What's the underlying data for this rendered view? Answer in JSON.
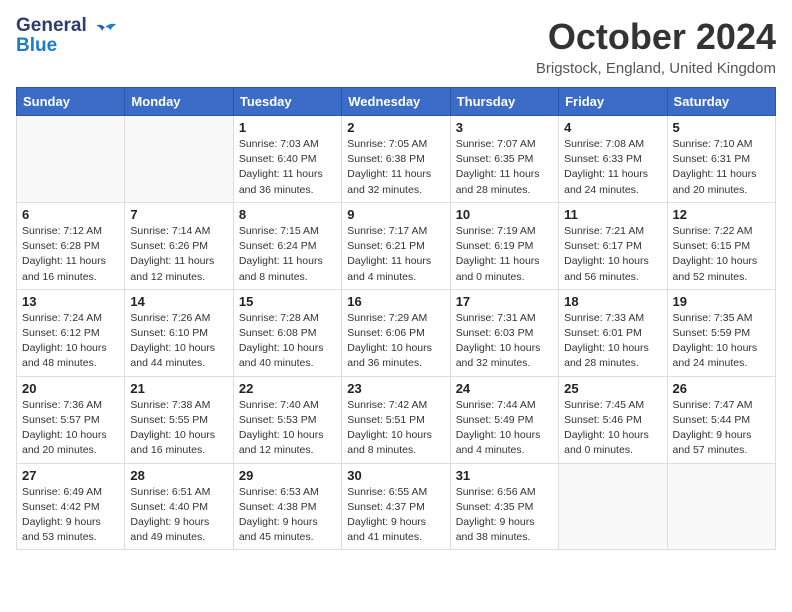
{
  "header": {
    "logo_line1": "General",
    "logo_line2": "Blue",
    "month_title": "October 2024",
    "location": "Brigstock, England, United Kingdom"
  },
  "days_of_week": [
    "Sunday",
    "Monday",
    "Tuesday",
    "Wednesday",
    "Thursday",
    "Friday",
    "Saturday"
  ],
  "weeks": [
    [
      {
        "day": "",
        "info": ""
      },
      {
        "day": "",
        "info": ""
      },
      {
        "day": "1",
        "info": "Sunrise: 7:03 AM\nSunset: 6:40 PM\nDaylight: 11 hours and 36 minutes."
      },
      {
        "day": "2",
        "info": "Sunrise: 7:05 AM\nSunset: 6:38 PM\nDaylight: 11 hours and 32 minutes."
      },
      {
        "day": "3",
        "info": "Sunrise: 7:07 AM\nSunset: 6:35 PM\nDaylight: 11 hours and 28 minutes."
      },
      {
        "day": "4",
        "info": "Sunrise: 7:08 AM\nSunset: 6:33 PM\nDaylight: 11 hours and 24 minutes."
      },
      {
        "day": "5",
        "info": "Sunrise: 7:10 AM\nSunset: 6:31 PM\nDaylight: 11 hours and 20 minutes."
      }
    ],
    [
      {
        "day": "6",
        "info": "Sunrise: 7:12 AM\nSunset: 6:28 PM\nDaylight: 11 hours and 16 minutes."
      },
      {
        "day": "7",
        "info": "Sunrise: 7:14 AM\nSunset: 6:26 PM\nDaylight: 11 hours and 12 minutes."
      },
      {
        "day": "8",
        "info": "Sunrise: 7:15 AM\nSunset: 6:24 PM\nDaylight: 11 hours and 8 minutes."
      },
      {
        "day": "9",
        "info": "Sunrise: 7:17 AM\nSunset: 6:21 PM\nDaylight: 11 hours and 4 minutes."
      },
      {
        "day": "10",
        "info": "Sunrise: 7:19 AM\nSunset: 6:19 PM\nDaylight: 11 hours and 0 minutes."
      },
      {
        "day": "11",
        "info": "Sunrise: 7:21 AM\nSunset: 6:17 PM\nDaylight: 10 hours and 56 minutes."
      },
      {
        "day": "12",
        "info": "Sunrise: 7:22 AM\nSunset: 6:15 PM\nDaylight: 10 hours and 52 minutes."
      }
    ],
    [
      {
        "day": "13",
        "info": "Sunrise: 7:24 AM\nSunset: 6:12 PM\nDaylight: 10 hours and 48 minutes."
      },
      {
        "day": "14",
        "info": "Sunrise: 7:26 AM\nSunset: 6:10 PM\nDaylight: 10 hours and 44 minutes."
      },
      {
        "day": "15",
        "info": "Sunrise: 7:28 AM\nSunset: 6:08 PM\nDaylight: 10 hours and 40 minutes."
      },
      {
        "day": "16",
        "info": "Sunrise: 7:29 AM\nSunset: 6:06 PM\nDaylight: 10 hours and 36 minutes."
      },
      {
        "day": "17",
        "info": "Sunrise: 7:31 AM\nSunset: 6:03 PM\nDaylight: 10 hours and 32 minutes."
      },
      {
        "day": "18",
        "info": "Sunrise: 7:33 AM\nSunset: 6:01 PM\nDaylight: 10 hours and 28 minutes."
      },
      {
        "day": "19",
        "info": "Sunrise: 7:35 AM\nSunset: 5:59 PM\nDaylight: 10 hours and 24 minutes."
      }
    ],
    [
      {
        "day": "20",
        "info": "Sunrise: 7:36 AM\nSunset: 5:57 PM\nDaylight: 10 hours and 20 minutes."
      },
      {
        "day": "21",
        "info": "Sunrise: 7:38 AM\nSunset: 5:55 PM\nDaylight: 10 hours and 16 minutes."
      },
      {
        "day": "22",
        "info": "Sunrise: 7:40 AM\nSunset: 5:53 PM\nDaylight: 10 hours and 12 minutes."
      },
      {
        "day": "23",
        "info": "Sunrise: 7:42 AM\nSunset: 5:51 PM\nDaylight: 10 hours and 8 minutes."
      },
      {
        "day": "24",
        "info": "Sunrise: 7:44 AM\nSunset: 5:49 PM\nDaylight: 10 hours and 4 minutes."
      },
      {
        "day": "25",
        "info": "Sunrise: 7:45 AM\nSunset: 5:46 PM\nDaylight: 10 hours and 0 minutes."
      },
      {
        "day": "26",
        "info": "Sunrise: 7:47 AM\nSunset: 5:44 PM\nDaylight: 9 hours and 57 minutes."
      }
    ],
    [
      {
        "day": "27",
        "info": "Sunrise: 6:49 AM\nSunset: 4:42 PM\nDaylight: 9 hours and 53 minutes."
      },
      {
        "day": "28",
        "info": "Sunrise: 6:51 AM\nSunset: 4:40 PM\nDaylight: 9 hours and 49 minutes."
      },
      {
        "day": "29",
        "info": "Sunrise: 6:53 AM\nSunset: 4:38 PM\nDaylight: 9 hours and 45 minutes."
      },
      {
        "day": "30",
        "info": "Sunrise: 6:55 AM\nSunset: 4:37 PM\nDaylight: 9 hours and 41 minutes."
      },
      {
        "day": "31",
        "info": "Sunrise: 6:56 AM\nSunset: 4:35 PM\nDaylight: 9 hours and 38 minutes."
      },
      {
        "day": "",
        "info": ""
      },
      {
        "day": "",
        "info": ""
      }
    ]
  ]
}
